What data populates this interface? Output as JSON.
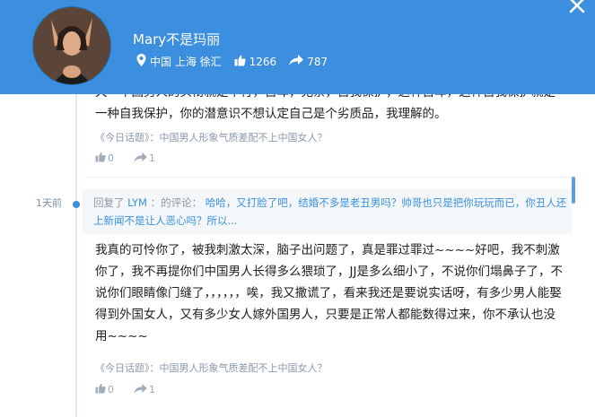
{
  "profile": {
    "name": "Mary不是玛丽",
    "location": "中国 上海 徐汇",
    "likes": "1266",
    "shares": "787"
  },
  "colors": {
    "header": "#3b8fde",
    "accent": "#3b8fde",
    "text": "#1e1e1e",
    "muted": "#8c99a8"
  },
  "icons": {
    "close": "close-icon",
    "location": "location-pin-icon",
    "like": "thumbs-up-icon",
    "share": "share-arrow-icon"
  },
  "comments": [
    {
      "text": "天一中国男人的头衔就是不行，自卑，无奈，自我保护，这种自卑，这种自我保护就是一种自我保护，你的潜意识不想认定自己是个劣质品，我理解的。",
      "topic": "《今日话题》：中国男人形象气质差配不上中国女人？",
      "likes": "0",
      "shares": "1"
    },
    {
      "time": "1天前",
      "reply_prefix": "回复了",
      "reply_user": "LYM",
      "reply_suffix": "：的评论：",
      "reply_quote": "哈哈，又打脸了吧，结婚不多是老丑男吗？帅哥也只是把你玩玩而已，你丑人还上新闻不是让人恶心吗？所以...",
      "text": "我真的可怜你了，被我刺激太深，脑子出问题了，真是罪过罪过~~~~好吧，我不刺激你了，我不再提你们中国男人长得多么猥琐了，JJ是多么细小了，不说你们塌鼻子了，不说你们眼睛像门缝了，，，，，，唉，我又撒谎了，看来我还是要说实话呀，有多少男人能娶得到外国女人，又有多少女人嫁外国男人，只要是正常人都能数得过来，你不承认也没用~~~~",
      "topic": "《今日话题》：中国男人形象气质差配不上中国女人？",
      "likes": "0",
      "shares": "1"
    }
  ]
}
